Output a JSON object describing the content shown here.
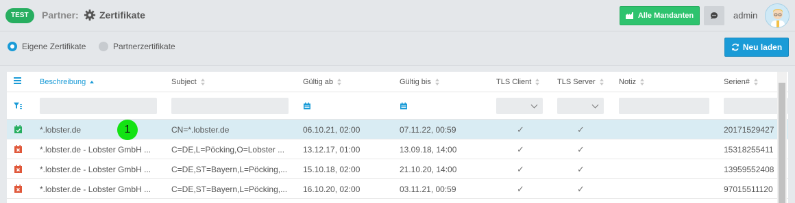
{
  "header": {
    "env_badge": "TEST",
    "breadcrumb_prefix": "Partner:",
    "title": "Zertifikate",
    "mandanten_label": "Alle Mandanten",
    "user": "admin"
  },
  "toolbar": {
    "radio_own": "Eigene Zertifikate",
    "radio_partner": "Partnerzertifikate",
    "reload_label": "Neu laden"
  },
  "table": {
    "columns": {
      "beschreibung": "Beschreibung",
      "subject": "Subject",
      "gueltig_ab": "Gültig ab",
      "gueltig_bis": "Gültig bis",
      "tls_client": "TLS Client",
      "tls_server": "TLS Server",
      "notiz": "Notiz",
      "serien": "Serien#"
    },
    "rows": [
      {
        "status": "valid",
        "beschreibung": "*.lobster.de",
        "subject": "CN=*.lobster.de",
        "gueltig_ab": "06.10.21, 02:00",
        "gueltig_bis": "07.11.22, 00:59",
        "tls_client": "✓",
        "tls_server": "✓",
        "notiz": "",
        "serien": "20171529427"
      },
      {
        "status": "expired",
        "beschreibung": "*.lobster.de - Lobster GmbH ...",
        "subject": "C=DE,L=Pöcking,O=Lobster ...",
        "gueltig_ab": "13.12.17, 01:00",
        "gueltig_bis": "13.09.18, 14:00",
        "tls_client": "✓",
        "tls_server": "✓",
        "notiz": "",
        "serien": "15318255411"
      },
      {
        "status": "expired",
        "beschreibung": "*.lobster.de - Lobster GmbH ...",
        "subject": "C=DE,ST=Bayern,L=Pöcking,...",
        "gueltig_ab": "15.10.18, 02:00",
        "gueltig_bis": "21.10.20, 14:00",
        "tls_client": "✓",
        "tls_server": "✓",
        "notiz": "",
        "serien": "13959552408"
      },
      {
        "status": "expired",
        "beschreibung": "*.lobster.de - Lobster GmbH ...",
        "subject": "C=DE,ST=Bayern,L=Pöcking,...",
        "gueltig_ab": "16.10.20, 02:00",
        "gueltig_bis": "03.11.21, 00:59",
        "tls_client": "✓",
        "tls_server": "✓",
        "notiz": "",
        "serien": "97015511120"
      }
    ]
  },
  "annotation": {
    "marker": "1"
  },
  "colors": {
    "accent": "#1a9bd7",
    "success": "#2ec36e",
    "danger": "#e0583a",
    "selected_row": "#d9ecf3"
  }
}
